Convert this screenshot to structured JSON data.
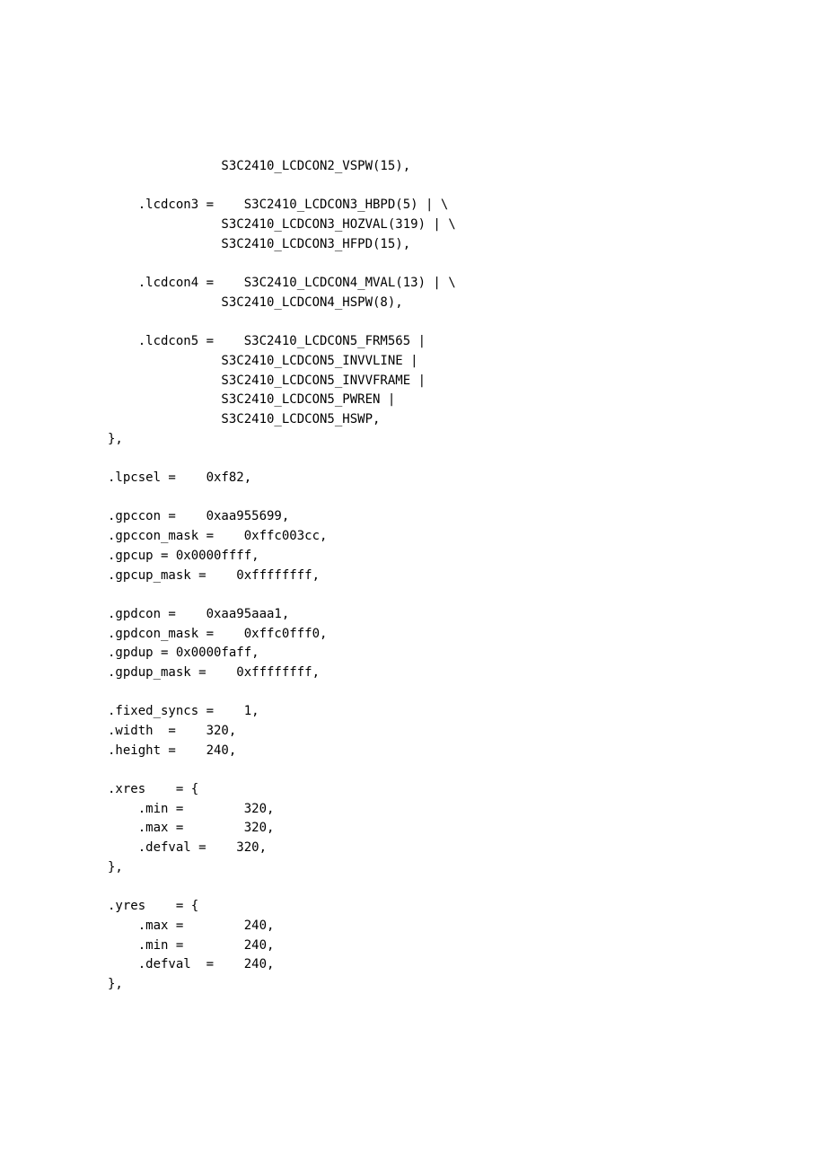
{
  "lines": [
    "               S3C2410_LCDCON2_VSPW(15),",
    "",
    "    .lcdcon3 =    S3C2410_LCDCON3_HBPD(5) | \\",
    "               S3C2410_LCDCON3_HOZVAL(319) | \\",
    "               S3C2410_LCDCON3_HFPD(15),",
    "",
    "    .lcdcon4 =    S3C2410_LCDCON4_MVAL(13) | \\",
    "               S3C2410_LCDCON4_HSPW(8),",
    "",
    "    .lcdcon5 =    S3C2410_LCDCON5_FRM565 |",
    "               S3C2410_LCDCON5_INVVLINE |",
    "               S3C2410_LCDCON5_INVVFRAME |",
    "               S3C2410_LCDCON5_PWREN |",
    "               S3C2410_LCDCON5_HSWP,",
    "},",
    "",
    ".lpcsel =    0xf82,",
    "",
    ".gpccon =    0xaa955699,",
    ".gpccon_mask =    0xffc003cc,",
    ".gpcup = 0x0000ffff,",
    ".gpcup_mask =    0xffffffff,",
    "",
    ".gpdcon =    0xaa95aaa1,",
    ".gpdcon_mask =    0xffc0fff0,",
    ".gpdup = 0x0000faff,",
    ".gpdup_mask =    0xffffffff,",
    "",
    ".fixed_syncs =    1,",
    ".width  =    320,",
    ".height =    240,",
    "",
    ".xres    = {",
    "    .min =        320,",
    "    .max =        320,",
    "    .defval =    320,",
    "},",
    "",
    ".yres    = {",
    "    .max =        240,",
    "    .min =        240,",
    "    .defval  =    240,",
    "},"
  ]
}
